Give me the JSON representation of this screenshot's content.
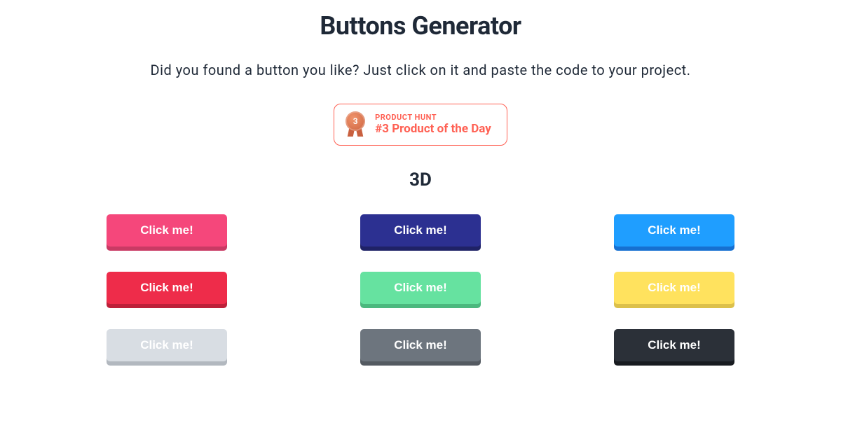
{
  "page": {
    "title": "Buttons Generator",
    "subtitle": "Did you found a button you like? Just click on it and paste the code to your project."
  },
  "productHunt": {
    "rank": "3",
    "topLabel": "PRODUCT HUNT",
    "bottomLabel": "#3 Product of the Day"
  },
  "section": {
    "title": "3D"
  },
  "buttons": [
    {
      "label": "Click me!",
      "bg": "#f5477b",
      "shadow": "#c93a64"
    },
    {
      "label": "Click me!",
      "bg": "#2c3091",
      "shadow": "#1f2266"
    },
    {
      "label": "Click me!",
      "bg": "#1f9eff",
      "shadow": "#1670d1"
    },
    {
      "label": "Click me!",
      "bg": "#ee2c4a",
      "shadow": "#bd2039"
    },
    {
      "label": "Click me!",
      "bg": "#66e2a0",
      "shadow": "#4bb87e"
    },
    {
      "label": "Click me!",
      "bg": "#ffe25e",
      "shadow": "#dcc04a"
    },
    {
      "label": "Click me!",
      "bg": "#d8dde3",
      "shadow": "#b2b8bf"
    },
    {
      "label": "Click me!",
      "bg": "#6d757e",
      "shadow": "#545a61"
    },
    {
      "label": "Click me!",
      "bg": "#2b3038",
      "shadow": "#181b20"
    }
  ]
}
